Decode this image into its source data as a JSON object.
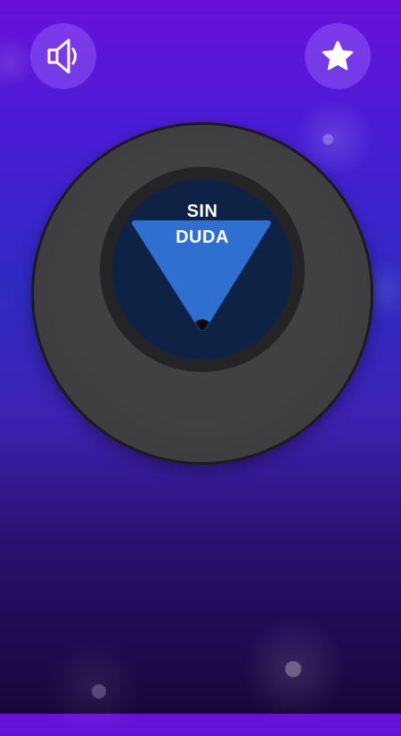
{
  "controls": {
    "sound_icon": "speaker-icon",
    "favorite_icon": "star-icon"
  },
  "ball": {
    "answer_line1": "SIN",
    "answer_line2": "DUDA"
  },
  "colors": {
    "background_top": "#6a10d8",
    "background_bottom": "#170639",
    "ball": "#414143",
    "window": "#0e2245",
    "triangle": "#2f6fcf"
  }
}
